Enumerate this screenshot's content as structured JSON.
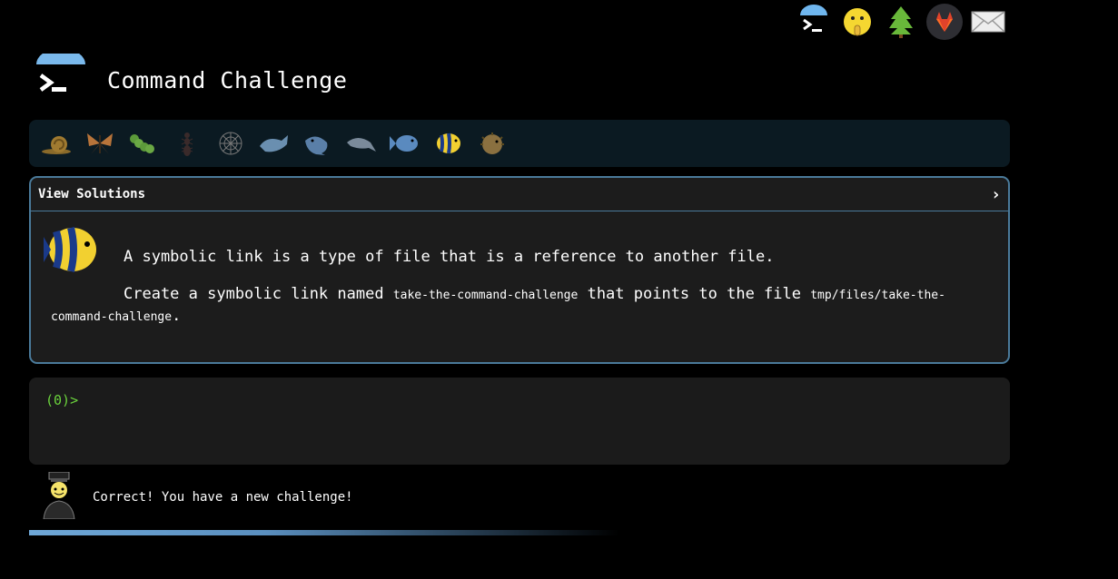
{
  "topbar": {
    "icons": [
      "terminal-icon",
      "shushing-face-icon",
      "tree-icon",
      "gitlab-icon",
      "mail-icon"
    ]
  },
  "header": {
    "title": "Command Challenge",
    "logo_icon": "terminal-icon"
  },
  "levels": [
    "snail-icon",
    "butterfly-icon",
    "caterpillar-icon",
    "ant-icon",
    "spider-web-icon",
    "whale-icon",
    "whale2-icon",
    "dolphin-icon",
    "fish-icon",
    "tropical-fish-icon",
    "blowfish-icon"
  ],
  "challenge": {
    "panel_label": "View Solutions",
    "chevron": "›",
    "line1": "A symbolic link is a type of file that is a reference to another file.",
    "line2_prefix": "Create a symbolic link named",
    "link_name": "take-the-command-challenge",
    "line2_middle": "that points to the file",
    "target_path": "tmp/files/take-the-command-challenge",
    "line2_suffix": "."
  },
  "terminal": {
    "prompt": "(0)>",
    "value": ""
  },
  "status": {
    "message": "Correct! You have a new challenge!"
  },
  "colors": {
    "accent": "#6fa8d8",
    "panel_border": "#4a7a9a",
    "prompt": "#6ad23c"
  }
}
